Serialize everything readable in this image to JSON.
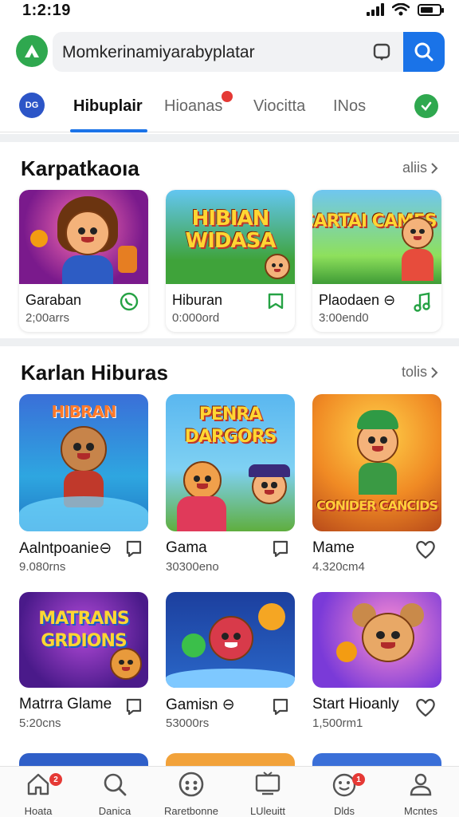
{
  "status": {
    "time": "1:2:19"
  },
  "search": {
    "query": "Momkerinamiyarabyplatar"
  },
  "tabs": [
    {
      "label": "Hibuplair",
      "active": true
    },
    {
      "label": "Hioanas",
      "active": false
    },
    {
      "label": "Viocitta",
      "active": false
    },
    {
      "label": "INos",
      "active": false
    }
  ],
  "tabs_avatar": "DG",
  "section1": {
    "title": "Karpatkaoıa",
    "link": "aliis",
    "items": [
      {
        "name": "Garaban",
        "meta": "2;00arrs",
        "thumb_title": ""
      },
      {
        "name": "Hiburan",
        "meta": "0:000ord",
        "thumb_title": "HIBIAN WIDASA"
      },
      {
        "name": "Plaodaen ⊖",
        "meta": "3:00end0",
        "thumb_title": "CARTAI CAMES"
      }
    ]
  },
  "section2": {
    "title": "Karlan Hiburas",
    "link": "tolis",
    "items": [
      {
        "name": "Aalntpoanie⊖",
        "meta": "9.080rns",
        "thumb_title": "HIBRAN"
      },
      {
        "name": "Gama",
        "meta": "30300eno",
        "thumb_title": "PENRA DARGORS"
      },
      {
        "name": "Mame",
        "meta": "4.320cm4",
        "thumb_title": "CONIDER CANCIDS"
      },
      {
        "name": "Matrra Glame",
        "meta": "5:20cns",
        "thumb_title": "MATRANS GRDIONS"
      },
      {
        "name": "Gamisn ⊖",
        "meta": "53000rs",
        "thumb_title": ""
      },
      {
        "name": "Start Hioanly",
        "meta": "1,500rm1",
        "thumb_title": ""
      }
    ]
  },
  "bottom_nav": [
    {
      "label": "Hoata",
      "icon": "home-icon",
      "badge": "2"
    },
    {
      "label": "Danica",
      "icon": "search-icon",
      "badge": ""
    },
    {
      "label": "Raretbonne",
      "icon": "gamepad-icon",
      "badge": ""
    },
    {
      "label": "LUleuitt",
      "icon": "tv-icon",
      "badge": ""
    },
    {
      "label": "Dlds",
      "icon": "smiley-icon",
      "badge": "1"
    },
    {
      "label": "Mcntes",
      "icon": "profile-icon",
      "badge": ""
    }
  ],
  "colors": {
    "accent": "#1a73e8",
    "green": "#2fa84f",
    "badge": "#e53935"
  }
}
